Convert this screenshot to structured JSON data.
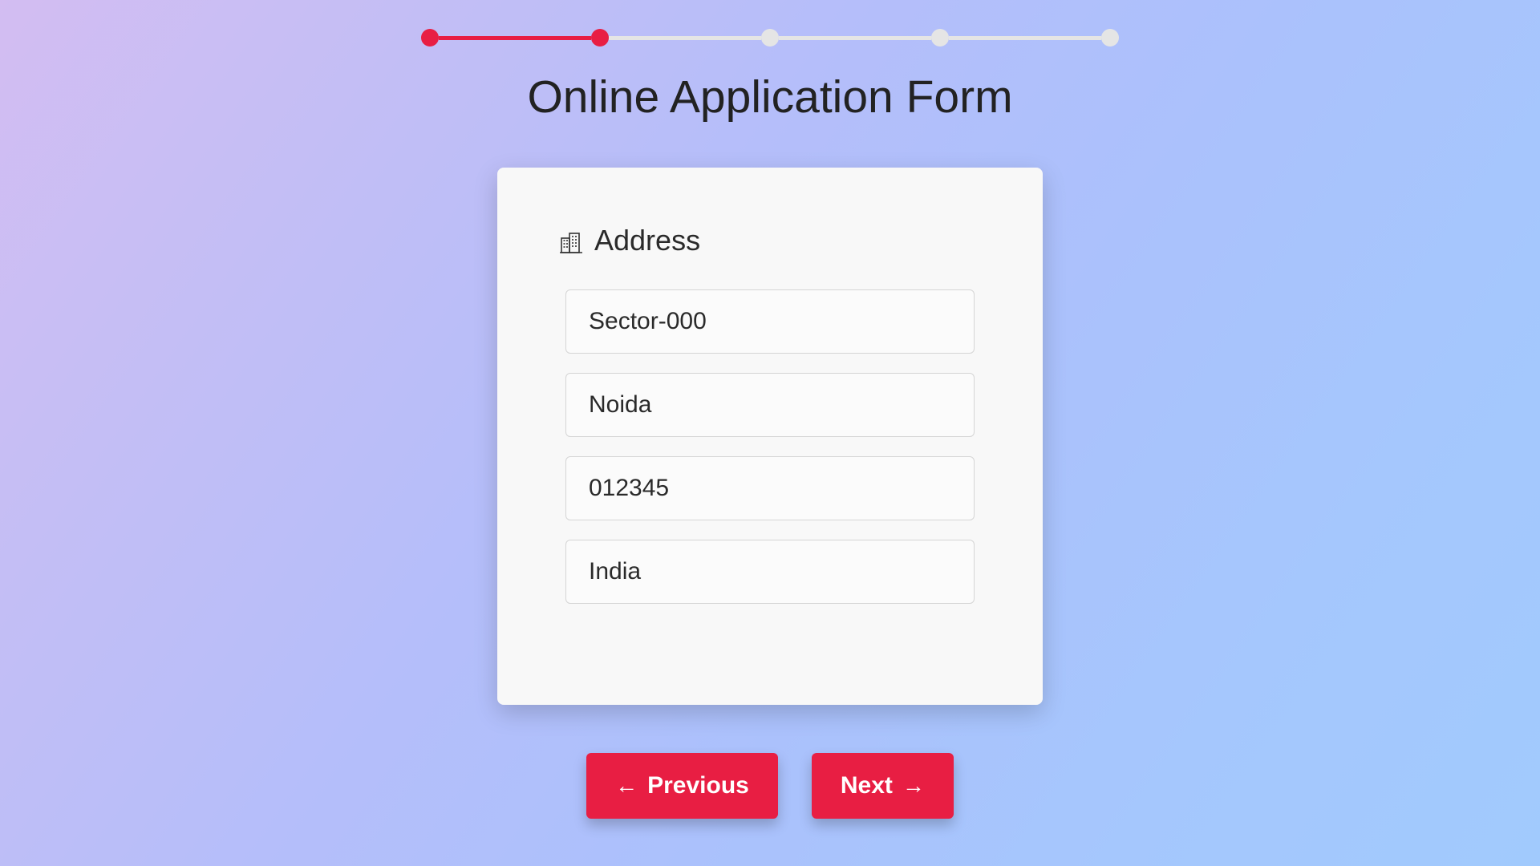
{
  "stepper": {
    "total": 5,
    "active": 2
  },
  "title": "Online Application Form",
  "section": {
    "heading": "Address",
    "icon": "buildings-icon"
  },
  "fields": {
    "street": {
      "value": "Sector-000"
    },
    "city": {
      "value": "Noida"
    },
    "postal": {
      "value": "012345"
    },
    "country": {
      "value": "India"
    }
  },
  "buttons": {
    "prev": "Previous",
    "next": "Next"
  },
  "colors": {
    "accent": "#e81e43",
    "card": "#f8f8f8"
  }
}
